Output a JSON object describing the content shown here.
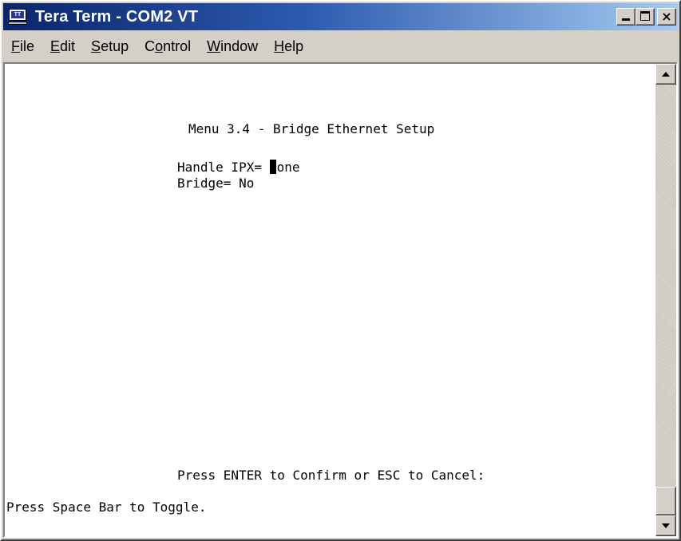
{
  "window": {
    "title": "Tera Term - COM2 VT",
    "icon": "tera-term-app-icon",
    "icon_badge": "TT",
    "controls": [
      "minimize",
      "maximize",
      "close"
    ],
    "close_glyph": "×"
  },
  "menu": {
    "file": {
      "mnemonic": "F",
      "rest": "ile"
    },
    "edit": {
      "mnemonic": "E",
      "rest": "dit"
    },
    "setup": {
      "mnemonic": "S",
      "rest": "etup"
    },
    "control": {
      "before": "C",
      "mnemonic": "o",
      "rest": "ntrol"
    },
    "window": {
      "mnemonic": "W",
      "rest": "indow"
    },
    "help": {
      "mnemonic": "H",
      "rest": "elp"
    }
  },
  "terminal": {
    "menu_title": "Menu 3.4 - Bridge Ethernet Setup",
    "handle_ipx_label": "Handle IPX= ",
    "handle_ipx_value_first": "N",
    "handle_ipx_value_rest": "one",
    "bridge_line": "Bridge= No",
    "confirm_prompt": "Press ENTER to Confirm or ESC to Cancel:",
    "toggle_hint": "Press Space Bar to Toggle."
  },
  "colors": {
    "title_gradient_start": "#0a246a",
    "title_gradient_end": "#a6caf0",
    "terminal_bg": "#ffffff",
    "terminal_fg": "#000000"
  }
}
